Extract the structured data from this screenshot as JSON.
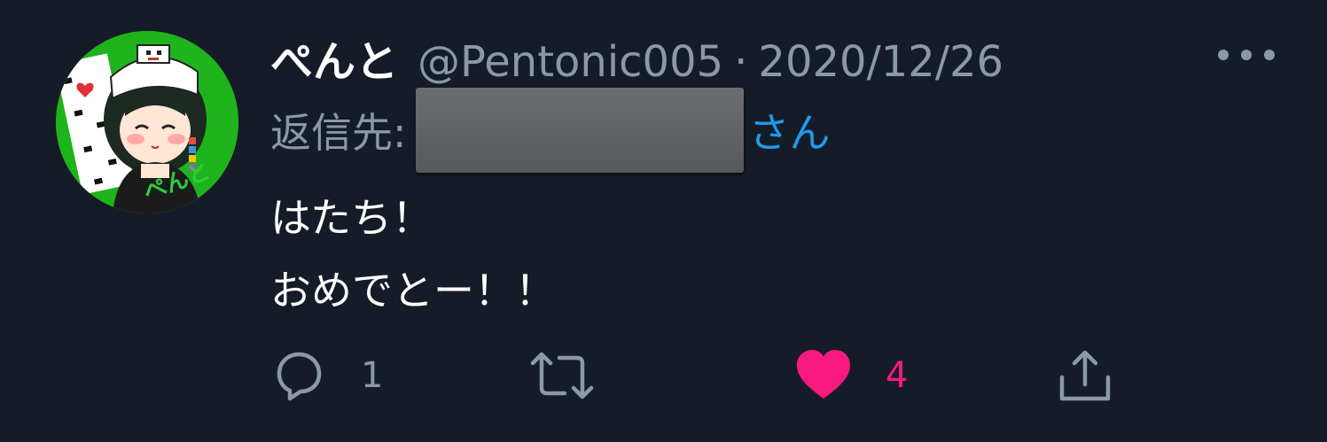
{
  "tweet": {
    "display_name": "ぺんと",
    "handle": "@Pentonic005",
    "separator": "·",
    "date": "2020/12/26",
    "reply_prefix": "返信先:",
    "reply_suffix": "さん",
    "body_lines": [
      "はたち！",
      "おめでとー！！"
    ]
  },
  "avatar": {
    "caption": "ぺんと",
    "background_color": "#1fb31c"
  },
  "actions": {
    "reply": {
      "icon": "reply-icon",
      "count": "1"
    },
    "retweet": {
      "icon": "retweet-icon",
      "count": ""
    },
    "like": {
      "icon": "heart-icon",
      "count": "4",
      "active": true
    },
    "share": {
      "icon": "share-icon"
    }
  },
  "colors": {
    "background": "#151c28",
    "primary_text": "#ffffff",
    "secondary_text": "#8b98a5",
    "link": "#1d9bf0",
    "like": "#f91880"
  }
}
